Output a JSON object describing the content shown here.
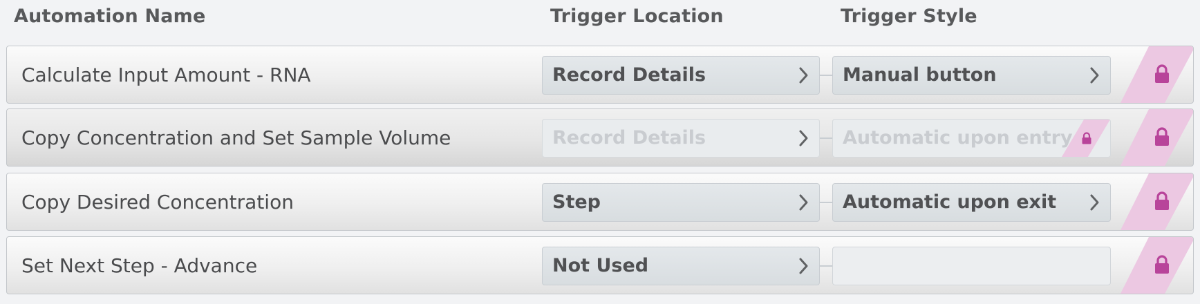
{
  "header": {
    "col_name": "Automation Name",
    "col_location": "Trigger Location",
    "col_style": "Trigger Style"
  },
  "colors": {
    "lock": "#b8449a",
    "lock_stripe": "#ecc8e2"
  },
  "rows": [
    {
      "name": "Calculate Input Amount - RNA",
      "location": "Record Details",
      "style": "Manual button",
      "locked": true
    },
    {
      "name": "Copy Concentration and Set Sample Volume",
      "location": "Record Details",
      "style": "Automatic upon entry",
      "locked": true,
      "disabled": true
    },
    {
      "name": "Copy Desired Concentration",
      "location": "Step",
      "style": "Automatic upon exit",
      "locked": true
    },
    {
      "name": "Set Next Step - Advance",
      "location": "Not Used",
      "style": "",
      "locked": true
    }
  ]
}
